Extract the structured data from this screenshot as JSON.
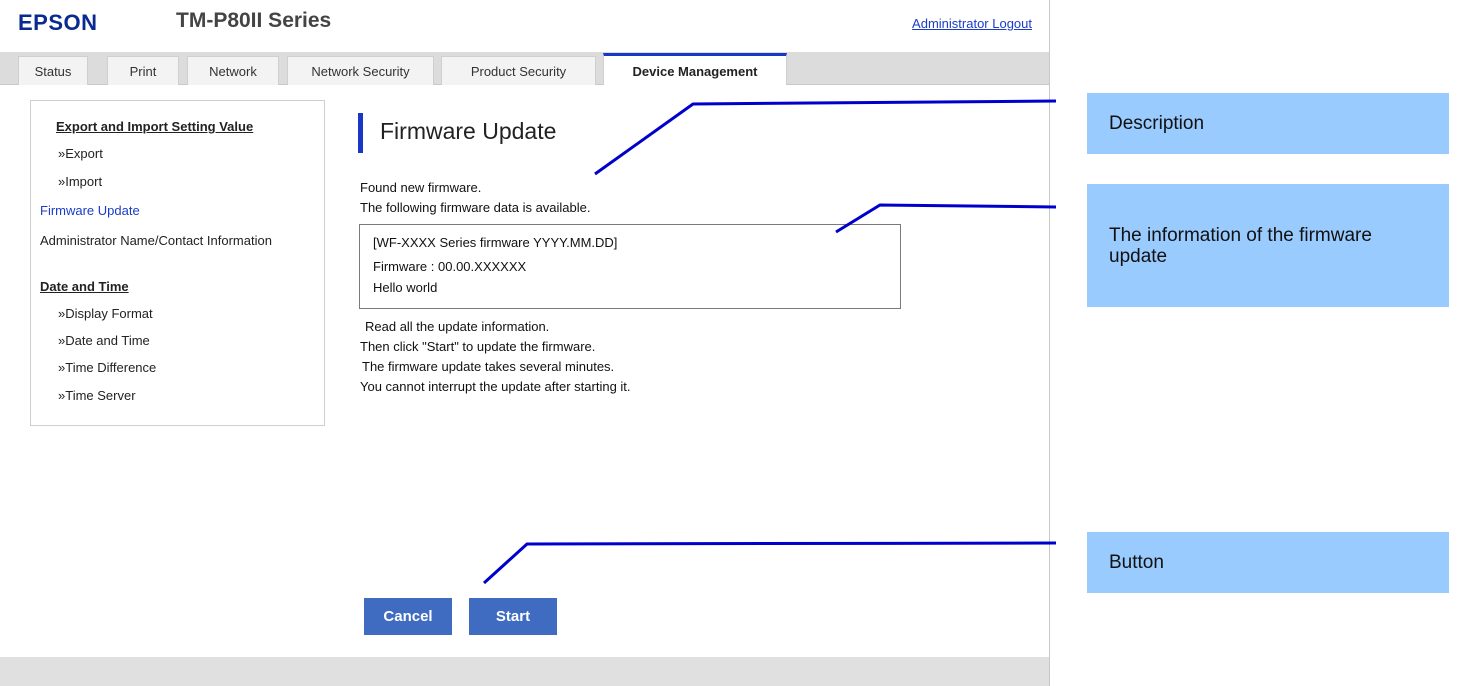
{
  "header": {
    "brand": "EPSON",
    "model": "TM-P80II Series",
    "logout_link": "Administrator Logout"
  },
  "tabs": [
    {
      "label": "Status"
    },
    {
      "label": "Print"
    },
    {
      "label": "Network"
    },
    {
      "label": "Network Security"
    },
    {
      "label": "Product Security"
    },
    {
      "label": "Device Management",
      "active": true
    }
  ],
  "sidebar": {
    "items": [
      {
        "label": "Export and Import Setting Value",
        "kind": "heading"
      },
      {
        "label": "»Export",
        "kind": "sub"
      },
      {
        "label": "»Import",
        "kind": "sub"
      },
      {
        "label": "Firmware Update",
        "kind": "active"
      },
      {
        "label": "Administrator Name/Contact Information",
        "kind": "item"
      },
      {
        "label": "Date and Time",
        "kind": "heading"
      },
      {
        "label": "»Display Format",
        "kind": "sub"
      },
      {
        "label": "»Date and Time",
        "kind": "sub"
      },
      {
        "label": "»Time Difference",
        "kind": "sub"
      },
      {
        "label": "»Time Server",
        "kind": "sub"
      }
    ]
  },
  "main": {
    "title": "Firmware Update",
    "found_lines": [
      "Found new firmware.",
      "The following firmware data is available."
    ],
    "firmware_info": [
      "[WF-XXXX Series firmware  YYYY.MM.DD]",
      "Firmware : 00.00.XXXXXX",
      "Hello world"
    ],
    "instructions": [
      "Read all the update information.",
      "Then click \"Start\" to update the firmware.",
      " The firmware update takes several minutes.",
      "You cannot interrupt the update after starting it."
    ],
    "cancel_label": "Cancel",
    "start_label": "Start"
  },
  "annotations": {
    "description": "Description",
    "firmware_info": "The information of the firmware update",
    "button": "Button",
    "line_color": "#0000cc",
    "box_color": "#99cbff"
  },
  "colors": {
    "brand": "#0b2a8f",
    "accent": "#1a36c6",
    "button": "#3f6cc0",
    "link": "#1a3cc8"
  }
}
